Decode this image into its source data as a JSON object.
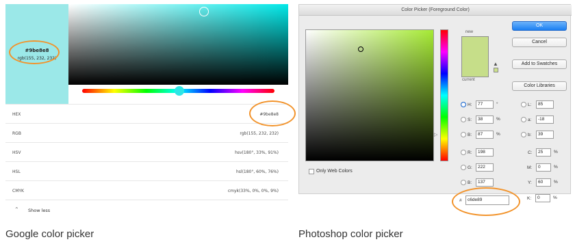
{
  "google": {
    "swatch_color": "#9be8e8",
    "swatch_hex": "#9be8e8",
    "swatch_rgb": "rgb(155, 232, 232)",
    "rows": [
      {
        "key": "HEX",
        "value": "#9be8e8"
      },
      {
        "key": "RGB",
        "value": "rgb(155, 232, 232)"
      },
      {
        "key": "HSV",
        "value": "hsv(180°, 33%, 91%)"
      },
      {
        "key": "HSL",
        "value": "hsl(180°, 60%, 76%)"
      },
      {
        "key": "CMYK",
        "value": "cmyk(33%, 0%, 0%, 9%)"
      }
    ],
    "show_less_label": "Show less",
    "caption": "Google color picker"
  },
  "photoshop": {
    "title": "Color Picker (Foreground Color)",
    "new_label": "new",
    "current_label": "current",
    "new_color": "#c6de89",
    "buttons": {
      "ok": "OK",
      "cancel": "Cancel",
      "add_swatches": "Add to Swatches",
      "color_libraries": "Color Libraries"
    },
    "hsb": [
      {
        "label": "H:",
        "value": "77",
        "unit": "°",
        "selected": true
      },
      {
        "label": "S:",
        "value": "38",
        "unit": "%",
        "selected": false
      },
      {
        "label": "B:",
        "value": "87",
        "unit": "%",
        "selected": false
      }
    ],
    "rgb": [
      {
        "label": "R:",
        "value": "198"
      },
      {
        "label": "G:",
        "value": "222"
      },
      {
        "label": "B:",
        "value": "137"
      }
    ],
    "lab": [
      {
        "label": "L:",
        "value": "85"
      },
      {
        "label": "a:",
        "value": "-18"
      },
      {
        "label": "b:",
        "value": "39"
      }
    ],
    "cmyk": [
      {
        "label": "C:",
        "value": "25",
        "unit": "%"
      },
      {
        "label": "M:",
        "value": "0",
        "unit": "%"
      },
      {
        "label": "Y:",
        "value": "60",
        "unit": "%"
      },
      {
        "label": "K:",
        "value": "0",
        "unit": "%"
      }
    ],
    "hex_prefix": "#",
    "hex_value": "c6de89",
    "only_web_colors_label": "Only Web Colors",
    "caption": "Photoshop color picker"
  },
  "highlight_color": "#f2932b"
}
